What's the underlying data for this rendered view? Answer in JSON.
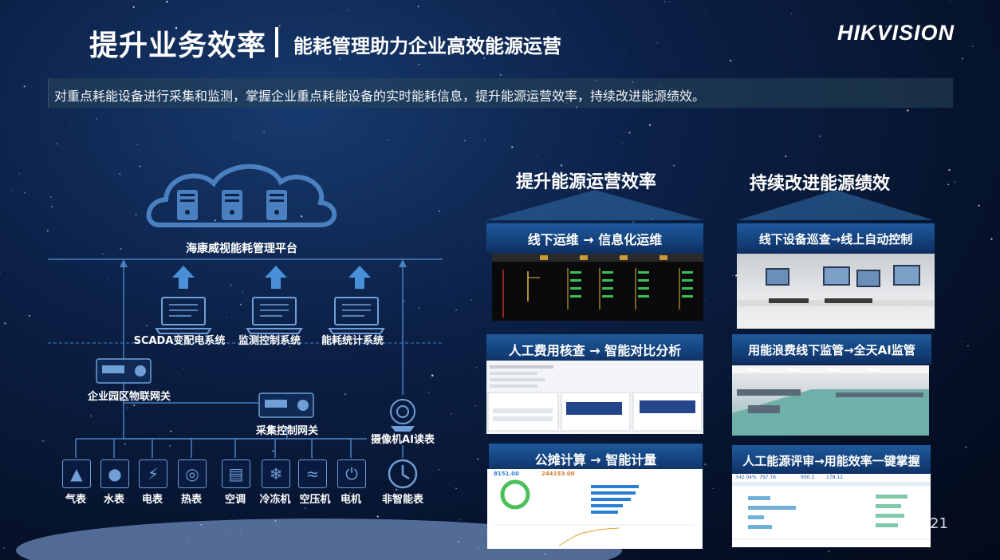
{
  "header": {
    "title": "提升业务效率",
    "subtitle": "能耗管理助力企业高效能源运营",
    "logo": "HIKVISION"
  },
  "description": "对重点耗能设备进行采集和监测，掌握企业重点耗能设备的实时能耗信息，提升能源运营效率，持续改进能源绩效。",
  "diagram": {
    "platform": "海康威视能耗管理平台",
    "systems": [
      "SCADA变配电系统",
      "监测控制系统",
      "能耗统计系统"
    ],
    "park_gateway": "企业园区物联网关",
    "collect_gateway": "采集控制网关",
    "camera": "摄像机AI读表",
    "meters": [
      "气表",
      "水表",
      "电表",
      "热表",
      "空调",
      "冷冻机",
      "空压机",
      "电机",
      "非智能表"
    ]
  },
  "columns": {
    "left_title": "提升能源运营效率",
    "right_title": "持续改进能源绩效",
    "left_cards": [
      "线下运维 → 信息化运维",
      "人工费用核查 → 智能对比分析",
      "公摊计算 → 智能计量"
    ],
    "right_cards": [
      "线下设备巡查→线上自动控制",
      "用能浪费线下监管→全天AI监管",
      "人工能源评审→用能效率一键掌握"
    ]
  },
  "screens": {
    "stat_a": "8151.00",
    "stat_b": "244153.00",
    "stat_c": "342.04%",
    "stat_d": "797.76",
    "stat_e": "900.2",
    "stat_f": "178.12"
  },
  "page_number": "21",
  "colors": {
    "accent": "#4a90d9",
    "card_head": "#1e5a9c",
    "background": "#06132c"
  }
}
